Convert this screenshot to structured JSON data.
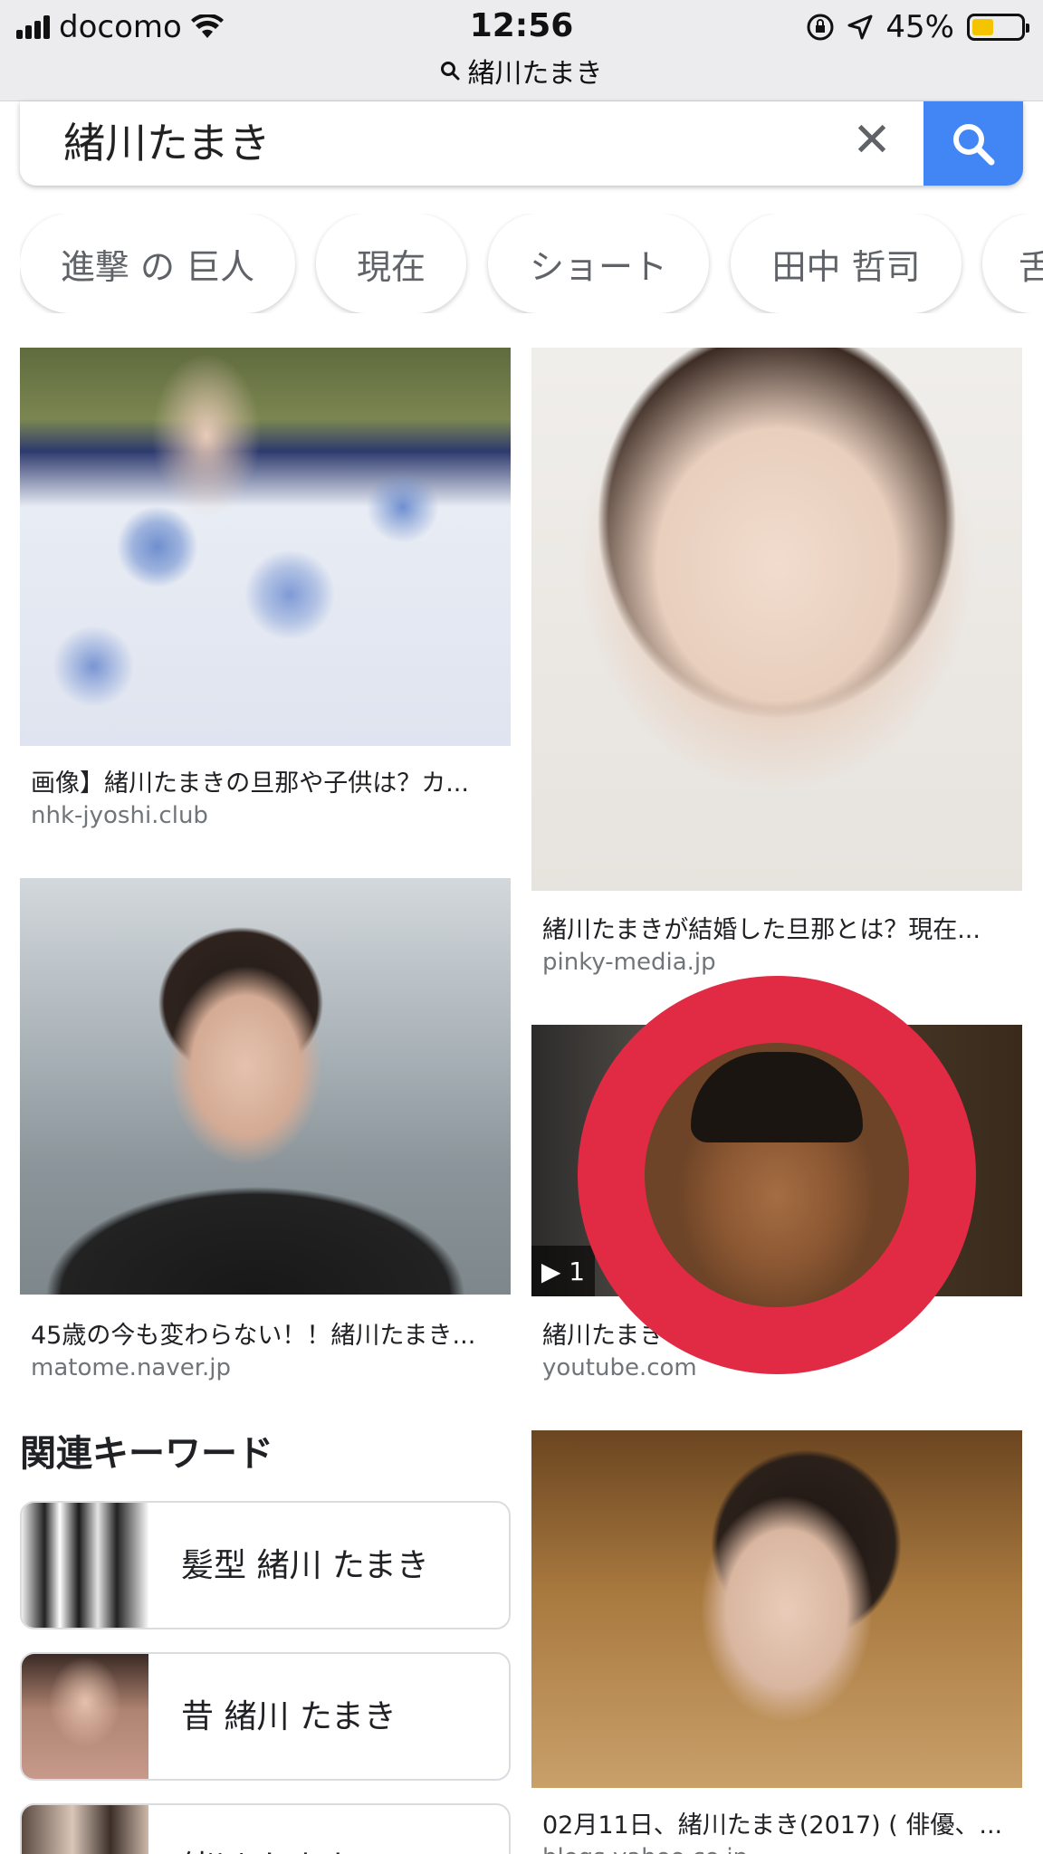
{
  "status_bar": {
    "carrier": "docomo",
    "time": "12:56",
    "battery": "45%",
    "battery_level": 0.45,
    "battery_color": "#f5c400",
    "url": "緒川たまき"
  },
  "search": {
    "query": "緒川たまき",
    "accent_color": "#4285f4"
  },
  "chips": [
    "進撃 の 巨人",
    "現在",
    "ショート",
    "田中 哲司",
    "舌"
  ],
  "results": [
    {
      "title": "画像】緒川たまきの旦那や子供は？カ...",
      "source": "nhk-jyoshi.club"
    },
    {
      "title": "緒川たまきが結婚した旦那とは？現在...",
      "source": "pinky-media.jp"
    },
    {
      "title": "45歳の今も変わらない！！緒川たまき...",
      "source": "matome.naver.jp"
    },
    {
      "title": "緒川たまき",
      "source": "youtube.com",
      "duration": "1"
    },
    {
      "title": "02月11日、緒川たまき(2017) ( 俳優、...",
      "source": "blogs.yahoo.co.jp"
    }
  ],
  "related": {
    "title": "関連キーワード",
    "items": [
      "髪型 緒川 たまき",
      "昔 緒川 たまき",
      "緒川 たまき ..."
    ]
  },
  "overlay": {
    "ring_color": "#e12a44"
  }
}
